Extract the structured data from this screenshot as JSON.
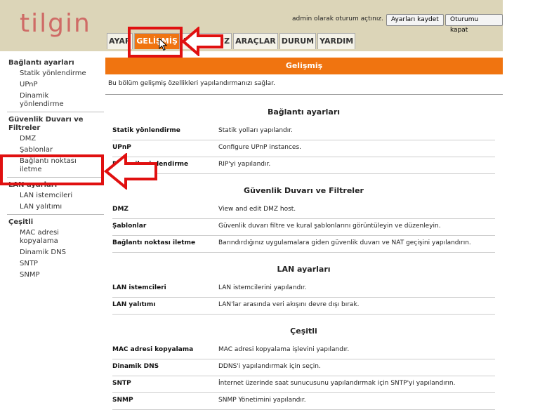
{
  "header": {
    "logo": "tilgin",
    "login_status": "admin olarak oturum açtınız.",
    "save_button": "Ayarları kaydet",
    "logout_button": "Oturumu kapat"
  },
  "tabs": [
    {
      "label": "AYAR"
    },
    {
      "label": "GELİŞMİŞ",
      "active": true
    },
    {
      "label": "KABLOSUZ"
    },
    {
      "label": "ARAÇLAR"
    },
    {
      "label": "DURUM"
    },
    {
      "label": "YARDIM"
    }
  ],
  "sidebar": {
    "groups": [
      {
        "title": "Bağlantı ayarları",
        "items": [
          "Statik yönlendirme",
          "UPnP",
          "Dinamik yönlendirme"
        ]
      },
      {
        "title": "Güvenlik Duvarı ve Filtreler",
        "items": [
          "DMZ",
          "Şablonlar",
          "Bağlantı noktası iletme"
        ]
      },
      {
        "title": "LAN ayarları",
        "items": [
          "LAN istemcileri",
          "LAN yalıtımı"
        ]
      },
      {
        "title": "Çeşitli",
        "items": [
          "MAC adresi kopyalama",
          "Dinamik DNS",
          "SNTP",
          "SNMP"
        ]
      }
    ]
  },
  "main": {
    "title": "Gelişmiş",
    "intro": "Bu bölüm gelişmiş özellikleri yapılandırmanızı sağlar.",
    "sections": [
      {
        "title": "Bağlantı ayarları",
        "rows": [
          {
            "name": "Statik yönlendirme",
            "desc": "Statik yolları yapılandır."
          },
          {
            "name": "UPnP",
            "desc": "Configure UPnP instances."
          },
          {
            "name": "Dinamik yönlendirme",
            "desc": "RIP'yi yapılandır."
          }
        ]
      },
      {
        "title": "Güvenlik Duvarı ve Filtreler",
        "rows": [
          {
            "name": "DMZ",
            "desc": "View and edit DMZ host."
          },
          {
            "name": "Şablonlar",
            "desc": "Güvenlik duvarı filtre ve kural şablonlarını görüntüleyin ve düzenleyin."
          },
          {
            "name": "Bağlantı noktası iletme",
            "desc": "Barındırdığınız uygulamalara giden güvenlik duvarı ve NAT geçişini yapılandırın."
          }
        ]
      },
      {
        "title": "LAN ayarları",
        "rows": [
          {
            "name": "LAN istemcileri",
            "desc": "LAN istemcilerini yapılandır."
          },
          {
            "name": "LAN yalıtımı",
            "desc": "LAN'lar arasında veri akışını devre dışı bırak."
          }
        ]
      },
      {
        "title": "Çeşitli",
        "rows": [
          {
            "name": "MAC adresi kopyalama",
            "desc": "MAC adresi kopyalama işlevini yapılandır."
          },
          {
            "name": "Dinamik DNS",
            "desc": "DDNS'i yapılandırmak için seçin."
          },
          {
            "name": "SNTP",
            "desc": "İnternet üzerinde saat sunucusunu yapılandırmak için SNTP'yi yapılandırın."
          },
          {
            "name": "SNMP",
            "desc": "SNMP Yönetimini yapılandır."
          }
        ]
      }
    ]
  },
  "colors": {
    "accent": "#f07410",
    "header_bg": "#dcd5b8",
    "highlight": "#e01010",
    "logo": "#cf6b66"
  }
}
